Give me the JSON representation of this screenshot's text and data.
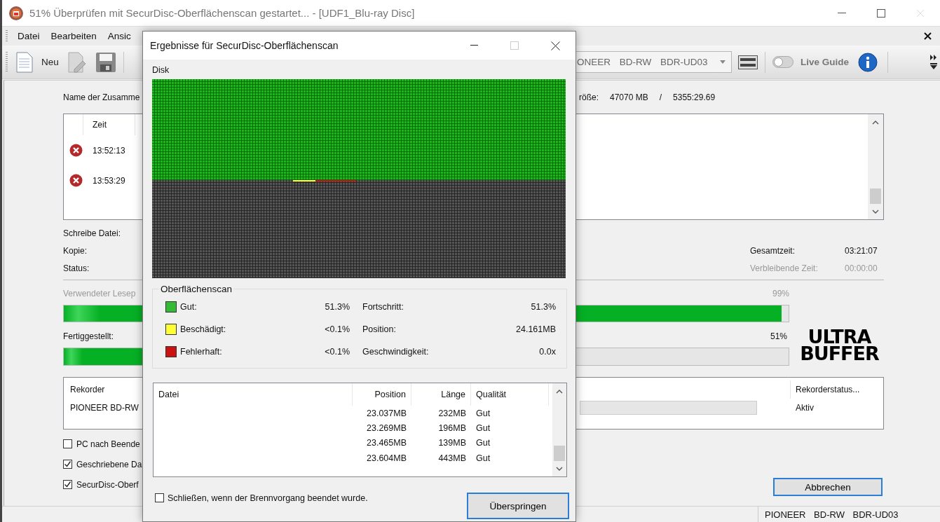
{
  "window": {
    "title": "51% Überprüfen mit SecurDisc-Oberflächenscan gestartet... - [UDF1_Blu-ray Disc]"
  },
  "menu": [
    "Datei",
    "Bearbeiten",
    "Ansic"
  ],
  "toolbar": {
    "new_label": "Neu",
    "recorder": "ONEER BD-RW BDR-UD03",
    "live_guide": {
      "label": "Live Guide",
      "on": false
    }
  },
  "main": {
    "compilation_label": "Name der Zusamme",
    "size_label": "röße:",
    "size_value": "47070 MB",
    "size_separator": "/",
    "size_time": "5355:29.69",
    "log": {
      "columns": [
        "Zeit"
      ],
      "rows": [
        {
          "kind": "error",
          "time": "13:52:13"
        },
        {
          "kind": "error",
          "time": "13:53:29"
        }
      ]
    },
    "info_labels": [
      "Schreibe Datei:",
      "Kopie:",
      "Status:"
    ],
    "times": [
      {
        "label": "Gesamtzeit:",
        "value": "03:21:07",
        "disabled": false
      },
      {
        "label": "Verbleibende Zeit:",
        "value": "00:00:00",
        "disabled": true
      }
    ],
    "progress": [
      {
        "label": "Verwendeter Lesep",
        "reading": "99%",
        "level": 0.99,
        "disabled": true
      },
      {
        "label": "Fertiggestellt:",
        "reading": "51%",
        "level": 0.51,
        "disabled": false
      }
    ],
    "logo": "ULTRA BUFFER",
    "recorders": {
      "columns": [
        "Rekorder",
        "Rekorderstatus..."
      ],
      "rows": [
        {
          "name": "PIONEER BD-RW",
          "level": 0,
          "status": "Aktiv"
        }
      ]
    },
    "options": [
      {
        "label": "PC nach Beende",
        "checked": false
      },
      {
        "label": "Geschriebene Da",
        "checked": true
      },
      {
        "label": "SecurDisc-Oberf",
        "checked": true
      }
    ],
    "cancel_button": "Abbrechen"
  },
  "status_bar": "PIONEER BD-RW BDR-UD03",
  "dialog": {
    "title": "Ergebnisse für SecurDisc-Oberflächenscan",
    "disk": {
      "label": "Disk"
    },
    "scan_title": "Oberflächenscan",
    "legend": [
      {
        "label": "Gut:",
        "value": "51.3%",
        "color": "#33bb33"
      },
      {
        "label": "Beschädigt:",
        "value": "<0.1%",
        "color": "#ffff33"
      },
      {
        "label": "Fehlerhaft:",
        "value": "<0.1%",
        "color": "#cc1111"
      }
    ],
    "stats": [
      {
        "label": "Fortschritt:",
        "value": "51.3%"
      },
      {
        "label": "Position:",
        "value": "24.161MB"
      },
      {
        "label": "Geschwindigkeit:",
        "value": "0.0x"
      }
    ],
    "table": {
      "columns": [
        "Datei",
        "Position",
        "Länge",
        "Qualität"
      ],
      "rows": [
        {
          "position": "23.037MB",
          "length": "232MB",
          "quality": "Gut"
        },
        {
          "position": "23.269MB",
          "length": "196MB",
          "quality": "Gut"
        },
        {
          "position": "23.465MB",
          "length": "139MB",
          "quality": "Gut"
        },
        {
          "position": "23.604MB",
          "length": "443MB",
          "quality": "Gut"
        }
      ]
    },
    "close_option": {
      "label": "Schließen, wenn der Brennvorgang beendet wurde.",
      "checked": false
    },
    "skip_button": "Überspringen"
  }
}
